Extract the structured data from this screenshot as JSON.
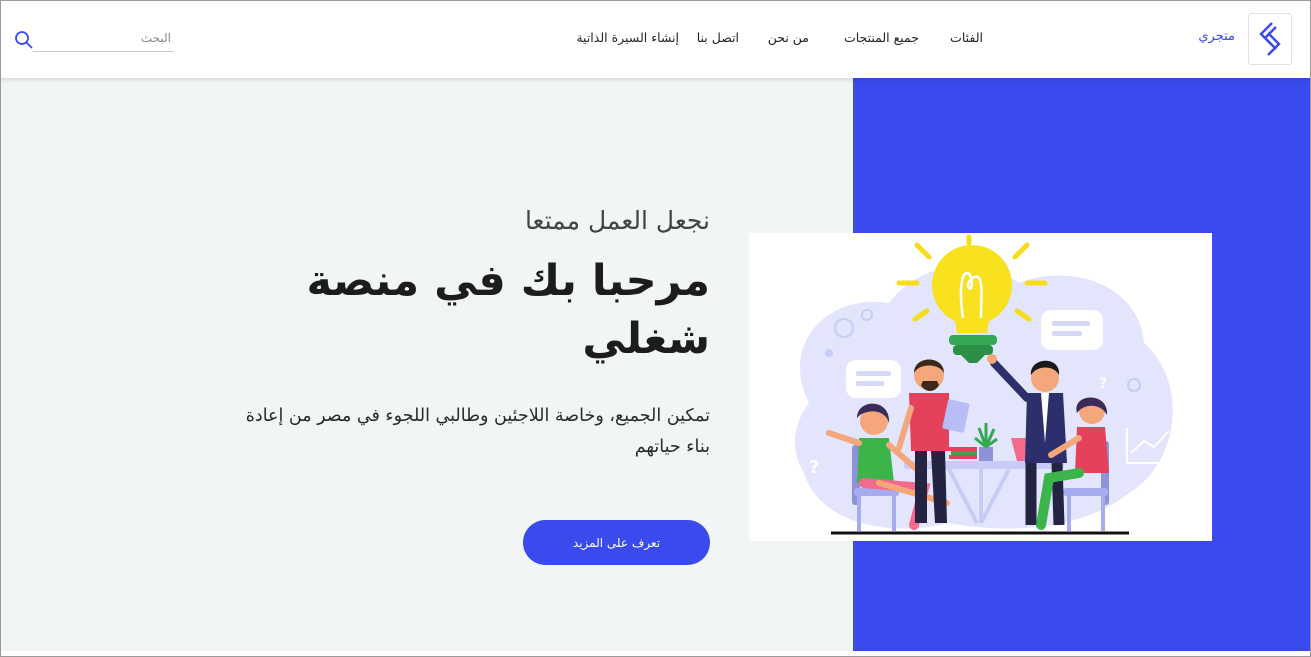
{
  "header": {
    "brand": "متجري",
    "nav": {
      "categories": "الفئات",
      "all_products": "جميع المنتجات",
      "about": "من نحن",
      "contact": "اتصل بنا",
      "create_cv": "إنشاء السيرة الذاتية"
    },
    "search": {
      "placeholder": "البحث",
      "value": ""
    }
  },
  "hero": {
    "tagline": "نجعل العمل ممتعا",
    "title": "مرحبا بك في منصة شغلي",
    "description": "تمكين الجميع، وخاصة اللاجئين وطالبي اللجوء في مصر من إعادة بناء حياتهم",
    "cta_label": "تعرف على المزيد"
  },
  "colors": {
    "accent": "#3a4aec",
    "hero_bg": "#f1f5f5",
    "text": "#1c1c1c"
  },
  "icons": {
    "logo": "brand-logo-icon",
    "search": "search-icon"
  }
}
